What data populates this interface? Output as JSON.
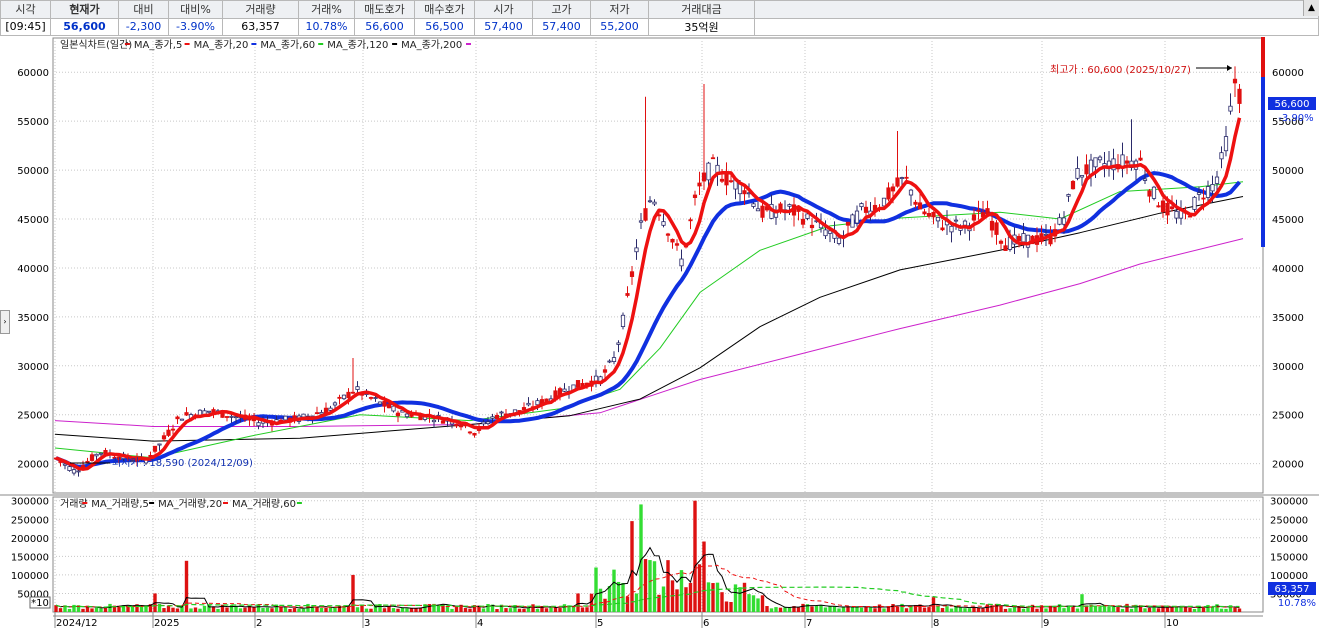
{
  "quote_header": {
    "columns": [
      "시각",
      "현재가",
      "대비",
      "대비%",
      "거래량",
      "거래%",
      "매도호가",
      "매수호가",
      "시가",
      "고가",
      "저가",
      "거래대금"
    ],
    "values": [
      "[09:45]",
      "56,600",
      "-2,300",
      "-3.90%",
      "63,357",
      "10.78%",
      "56,600",
      "56,500",
      "57,400",
      "57,400",
      "55,200",
      "35억원"
    ]
  },
  "price_chart": {
    "legend": [
      {
        "label": "일본식차트(일간)",
        "color": "#d01010"
      },
      {
        "label": "MA_종가,5",
        "color": "#ee1111"
      },
      {
        "label": "MA_종가,20",
        "color": "#1030e0"
      },
      {
        "label": "MA_종가,60",
        "color": "#22cc22"
      },
      {
        "label": "MA_종가,120",
        "color": "#000000"
      },
      {
        "label": "MA_종가,200",
        "color": "#cc22cc"
      }
    ],
    "y_ticks": [
      "60000",
      "55000",
      "50000",
      "45000",
      "40000",
      "35000",
      "30000",
      "25000",
      "20000"
    ],
    "high_annotation": "최고가 : 60,600 (2025/10/27)",
    "low_annotation": "최저가 : 18,590 (2024/12/09)",
    "current_price_tag": "56,600",
    "current_change_tag": "-3.90%"
  },
  "volume_chart": {
    "legend": [
      {
        "label": "거래량",
        "color": "#ee1111"
      },
      {
        "label": "MA_거래량,5",
        "color": "#000000"
      },
      {
        "label": "MA_거래량,20",
        "color": "#ee1111"
      },
      {
        "label": "MA_거래량,60",
        "color": "#22cc22"
      }
    ],
    "y_ticks": [
      "300000",
      "250000",
      "200000",
      "150000",
      "100000",
      "50000"
    ],
    "current_volume_tag": "63,357",
    "current_volume_pct_tag": "10.78%",
    "unit_tag": "*10"
  },
  "x_axis_labels": [
    "2024/12",
    "2025",
    "2",
    "3",
    "4",
    "5",
    "6",
    "7",
    "8",
    "9",
    "10"
  ],
  "colors": {
    "up": "#e01010",
    "down": "#1030e0",
    "grid": "#c8c8c8",
    "ma60": "#22cc22",
    "ma120": "#000000",
    "ma200": "#cc22cc"
  },
  "chart_data": {
    "type": "candlestick",
    "title": "일본식차트(일간)",
    "ylim": [
      17000,
      63500
    ],
    "approx_close_series": [
      [
        "2024/12",
        20500
      ],
      [
        "2025/01",
        23000
      ],
      [
        "2025/02",
        24800
      ],
      [
        "2025/03",
        26500
      ],
      [
        "2025/04",
        24200
      ],
      [
        "2025/05",
        28000
      ],
      [
        "2025/05 late",
        46000
      ],
      [
        "2025/06",
        50500
      ],
      [
        "2025/07",
        44000
      ],
      [
        "2025/08",
        44000
      ],
      [
        "2025/09",
        51000
      ],
      [
        "2025/10",
        48000
      ],
      [
        "2025/10/27",
        60600
      ],
      [
        "now",
        56600
      ]
    ],
    "volume_ylim": [
      0,
      300000
    ]
  }
}
